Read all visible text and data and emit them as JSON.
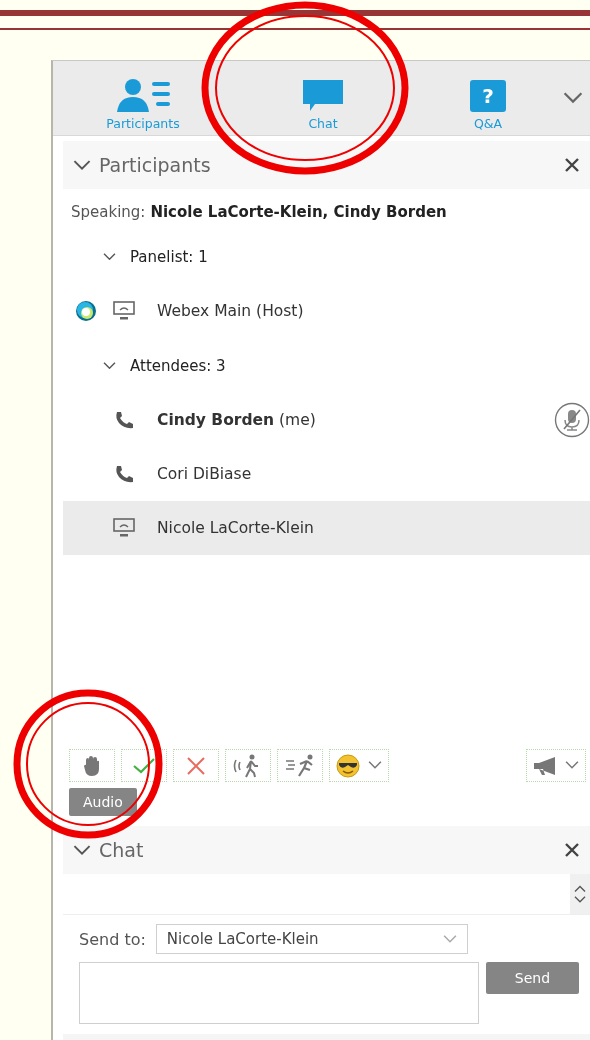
{
  "tabs": [
    {
      "label": "Participants",
      "kind": "participants"
    },
    {
      "label": "Chat",
      "kind": "chat"
    },
    {
      "label": "Q&A",
      "kind": "qa",
      "glyph": "?"
    }
  ],
  "participants_panel": {
    "title": "Participants",
    "expanded": true,
    "speaking_label": "Speaking:",
    "speaking_names": "Nicole LaCorte-Klein, Cindy Borden",
    "groups": [
      {
        "label": "Panelist: 1",
        "expanded": true,
        "members": [
          {
            "name": "Webex Main (Host)",
            "kind": "computer",
            "host": true,
            "muted": false,
            "selected": false
          }
        ]
      },
      {
        "label": "Attendees: 3",
        "expanded": true,
        "members": [
          {
            "name": "**Cindy Borden** (me)",
            "kind": "phone",
            "host": false,
            "muted": true,
            "selected": false
          },
          {
            "name": "Cori DiBiase",
            "kind": "phone",
            "host": false,
            "muted": false,
            "selected": false
          },
          {
            "name": "Nicole LaCorte-Klein",
            "kind": "computer",
            "host": false,
            "muted": false,
            "selected": true
          }
        ]
      }
    ]
  },
  "reactions": [
    {
      "kind": "raise-hand"
    },
    {
      "kind": "yes"
    },
    {
      "kind": "no"
    },
    {
      "kind": "slower"
    },
    {
      "kind": "faster"
    },
    {
      "kind": "emoji"
    }
  ],
  "tooltip": "Audio",
  "chat_panel": {
    "title": "Chat",
    "expanded": true,
    "send_to_label": "Send to:",
    "recipient": "Nicole LaCorte-Klein",
    "send_button": "Send"
  }
}
